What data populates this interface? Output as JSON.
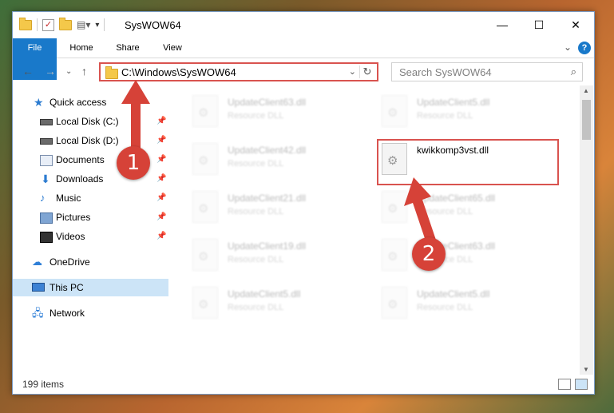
{
  "window": {
    "title": "SysWOW64",
    "controls": {
      "minimize": "—",
      "maximize": "☐",
      "close": "✕"
    }
  },
  "ribbon": {
    "tabs": [
      "File",
      "Home",
      "Share",
      "View"
    ],
    "help": "?"
  },
  "address": {
    "path": "C:\\Windows\\SysWOW64",
    "search_placeholder": "Search SysWOW64"
  },
  "nav": {
    "items": [
      {
        "label": "Quick access",
        "icon": "star-icon"
      },
      {
        "label": "Local Disk (C:)",
        "icon": "drive-icon",
        "pinned": true
      },
      {
        "label": "Local Disk (D:)",
        "icon": "drive-icon",
        "pinned": true
      },
      {
        "label": "Documents",
        "icon": "documents-icon",
        "pinned": true
      },
      {
        "label": "Downloads",
        "icon": "download-icon",
        "pinned": true
      },
      {
        "label": "Music",
        "icon": "music-icon",
        "pinned": true
      },
      {
        "label": "Pictures",
        "icon": "pictures-icon",
        "pinned": true
      },
      {
        "label": "Videos",
        "icon": "videos-icon",
        "pinned": true
      },
      {
        "label": "OneDrive",
        "icon": "cloud-icon"
      },
      {
        "label": "This PC",
        "icon": "computer-icon",
        "selected": true
      },
      {
        "label": "Network",
        "icon": "network-icon"
      }
    ]
  },
  "files": [
    {
      "name": "UpdateClient63.dll",
      "type": "Resource DLL"
    },
    {
      "name": "UpdateClient5.dll",
      "type": "Resource DLL"
    },
    {
      "name": "UpdateClient42.dll",
      "type": "Resource DLL"
    },
    {
      "name": "kwikkomp3vst.dll",
      "type": ""
    },
    {
      "name": "UpdateClient21.dll",
      "type": "Resource DLL"
    },
    {
      "name": "UpdateClient65.dll",
      "type": "Resource DLL"
    },
    {
      "name": "UpdateClient19.dll",
      "type": "Resource DLL"
    },
    {
      "name": "UpdateClient63.dll",
      "type": "Resource DLL"
    },
    {
      "name": "UpdateClient5.dll",
      "type": "Resource DLL"
    },
    {
      "name": "UpdateClient5.dll",
      "type": "Resource DLL"
    }
  ],
  "status": {
    "item_count": "199 items"
  },
  "annotations": {
    "marker1": "1",
    "marker2": "2"
  },
  "colors": {
    "accent": "#1979ca",
    "highlight": "#d9534f",
    "selected": "#cce4f7"
  }
}
